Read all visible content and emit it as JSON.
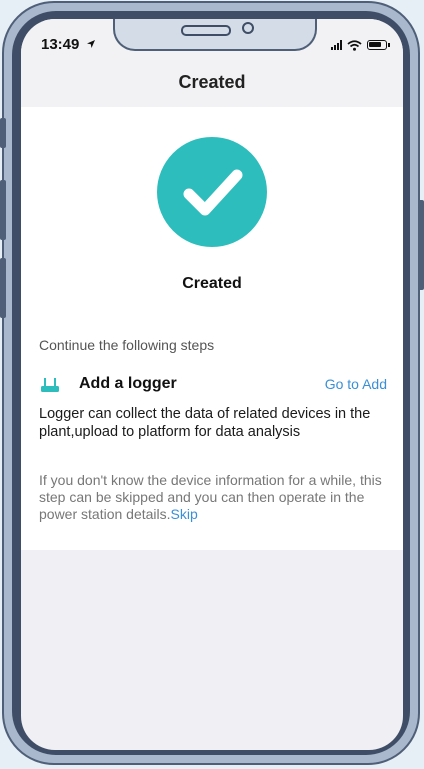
{
  "status_bar": {
    "time": "13:49"
  },
  "header": {
    "title": "Created"
  },
  "result": {
    "title": "Created",
    "accent_color": "#2ebdbd"
  },
  "steps": {
    "intro": "Continue the following steps",
    "logger": {
      "title": "Add a logger",
      "action_label": "Go to Add",
      "description": "Logger can collect the data of related devices in the plant,upload to platform for data analysis",
      "icon": "logger-icon"
    },
    "skip_note": {
      "text": "If you don't know the device information for a while, this step can be skipped and you can then operate in the power station details.",
      "link_label": "Skip"
    }
  },
  "colors": {
    "link": "#3a8fd6",
    "success": "#2ebdbd"
  }
}
